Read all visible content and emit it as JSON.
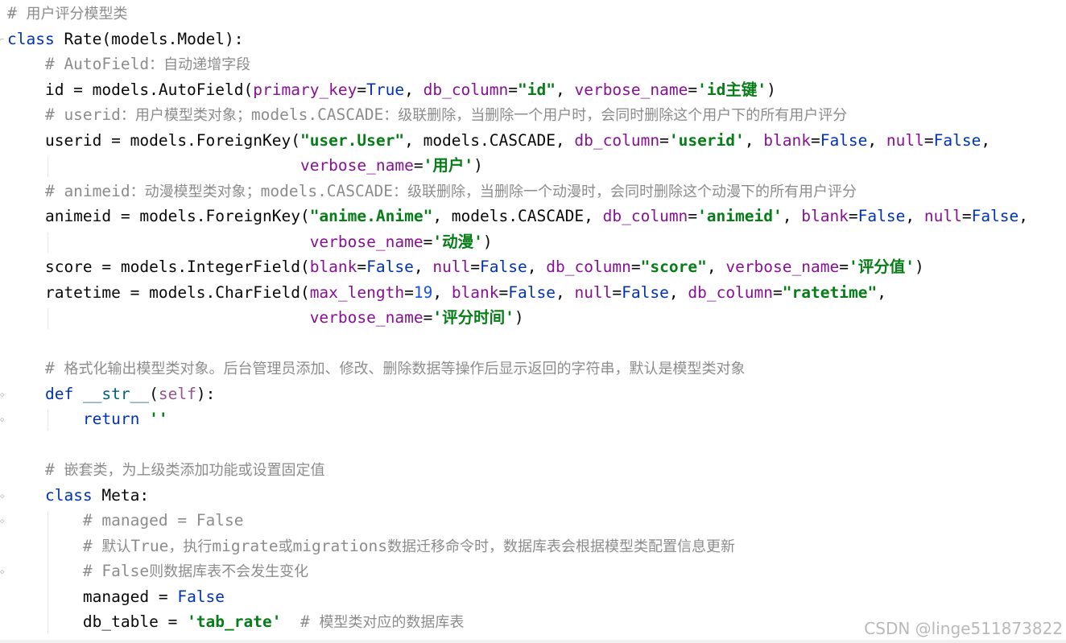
{
  "editor": {
    "lines": [
      [
        [
          "# ",
          "c"
        ],
        [
          "用户评分模型类",
          "cz"
        ]
      ],
      [
        [
          "class ",
          "k"
        ],
        [
          "Rate(models.Model):",
          ""
        ]
      ],
      [
        [
          "    # AutoField",
          "c"
        ],
        [
          "：自动递增字段",
          "cz"
        ]
      ],
      [
        [
          "    id = models.AutoField(",
          ""
        ],
        [
          "primary_key",
          "p"
        ],
        [
          "=",
          ""
        ],
        [
          "True",
          "k"
        ],
        [
          ", ",
          ""
        ],
        [
          "db_column",
          "p"
        ],
        [
          "=",
          ""
        ],
        [
          "\"id\"",
          "s"
        ],
        [
          ", ",
          ""
        ],
        [
          "verbose_name",
          "p"
        ],
        [
          "=",
          ""
        ],
        [
          "'id",
          "s"
        ],
        [
          "主键",
          "sz"
        ],
        [
          "'",
          "s"
        ],
        [
          ")",
          ""
        ]
      ],
      [
        [
          "    # userid",
          "c"
        ],
        [
          "：用户模型类对象；",
          "cz"
        ],
        [
          "models.CASCADE",
          "c"
        ],
        [
          "：级联删除，当删除一个用户时，会同时删除这个用户下的所有用户评分",
          "cz"
        ]
      ],
      [
        [
          "    userid = models.ForeignKey(",
          ""
        ],
        [
          "\"user.User\"",
          "s"
        ],
        [
          ", models.CASCADE, ",
          ""
        ],
        [
          "db_column",
          "p"
        ],
        [
          "=",
          ""
        ],
        [
          "'userid'",
          "s"
        ],
        [
          ", ",
          ""
        ],
        [
          "blank",
          "p"
        ],
        [
          "=",
          ""
        ],
        [
          "False",
          "k"
        ],
        [
          ", ",
          ""
        ],
        [
          "null",
          "p"
        ],
        [
          "=",
          ""
        ],
        [
          "False",
          "k"
        ],
        [
          ",",
          ""
        ]
      ],
      [
        [
          "                               ",
          ""
        ],
        [
          "verbose_name",
          "p"
        ],
        [
          "=",
          ""
        ],
        [
          "'",
          "s"
        ],
        [
          "用户",
          "sz"
        ],
        [
          "'",
          "s"
        ],
        [
          ")",
          ""
        ]
      ],
      [
        [
          "    # animeid",
          "c"
        ],
        [
          "：动漫模型类对象；",
          "cz"
        ],
        [
          "models.CASCADE",
          "c"
        ],
        [
          "：级联删除，当删除一个动漫时，会同时删除这个动漫下的所有用户评分",
          "cz"
        ]
      ],
      [
        [
          "    animeid = models.ForeignKey(",
          ""
        ],
        [
          "\"anime.Anime\"",
          "s"
        ],
        [
          ", models.CASCADE, ",
          ""
        ],
        [
          "db_column",
          "p"
        ],
        [
          "=",
          ""
        ],
        [
          "'animeid'",
          "s"
        ],
        [
          ", ",
          ""
        ],
        [
          "blank",
          "p"
        ],
        [
          "=",
          ""
        ],
        [
          "False",
          "k"
        ],
        [
          ", ",
          ""
        ],
        [
          "null",
          "p"
        ],
        [
          "=",
          ""
        ],
        [
          "False",
          "k"
        ],
        [
          ",",
          ""
        ]
      ],
      [
        [
          "                                ",
          ""
        ],
        [
          "verbose_name",
          "p"
        ],
        [
          "=",
          ""
        ],
        [
          "'",
          "s"
        ],
        [
          "动漫",
          "sz"
        ],
        [
          "'",
          "s"
        ],
        [
          ")",
          ""
        ]
      ],
      [
        [
          "    score = models.IntegerField(",
          ""
        ],
        [
          "blank",
          "p"
        ],
        [
          "=",
          ""
        ],
        [
          "False",
          "k"
        ],
        [
          ", ",
          ""
        ],
        [
          "null",
          "p"
        ],
        [
          "=",
          ""
        ],
        [
          "False",
          "k"
        ],
        [
          ", ",
          ""
        ],
        [
          "db_column",
          "p"
        ],
        [
          "=",
          ""
        ],
        [
          "\"score\"",
          "s"
        ],
        [
          ", ",
          ""
        ],
        [
          "verbose_name",
          "p"
        ],
        [
          "=",
          ""
        ],
        [
          "'",
          "s"
        ],
        [
          "评分值",
          "sz"
        ],
        [
          "'",
          "s"
        ],
        [
          ")",
          ""
        ]
      ],
      [
        [
          "    ratetime = models.CharField(",
          ""
        ],
        [
          "max_length",
          "p"
        ],
        [
          "=",
          ""
        ],
        [
          "19",
          "n"
        ],
        [
          ", ",
          ""
        ],
        [
          "blank",
          "p"
        ],
        [
          "=",
          ""
        ],
        [
          "False",
          "k"
        ],
        [
          ", ",
          ""
        ],
        [
          "null",
          "p"
        ],
        [
          "=",
          ""
        ],
        [
          "False",
          "k"
        ],
        [
          ", ",
          ""
        ],
        [
          "db_column",
          "p"
        ],
        [
          "=",
          ""
        ],
        [
          "\"ratetime\"",
          "s"
        ],
        [
          ",",
          ""
        ]
      ],
      [
        [
          "                                ",
          ""
        ],
        [
          "verbose_name",
          "p"
        ],
        [
          "=",
          ""
        ],
        [
          "'",
          "s"
        ],
        [
          "评分时间",
          "sz"
        ],
        [
          "'",
          "s"
        ],
        [
          ")",
          ""
        ]
      ],
      [],
      [
        [
          "    # ",
          "c"
        ],
        [
          "格式化输出模型类对象。后台管理员添加、修改、删除数据等操作后显示返回的字符串，默认是模型类对象",
          "cz"
        ]
      ],
      [
        [
          "    ",
          ""
        ],
        [
          "def ",
          "k"
        ],
        [
          "__str__",
          "fn"
        ],
        [
          "(",
          ""
        ],
        [
          "self",
          "sl"
        ],
        [
          "):",
          ""
        ]
      ],
      [
        [
          "        ",
          ""
        ],
        [
          "return ",
          "k"
        ],
        [
          "''",
          "s"
        ]
      ],
      [],
      [
        [
          "    # ",
          "c"
        ],
        [
          "嵌套类，为上级类添加功能或设置固定值",
          "cz"
        ]
      ],
      [
        [
          "    ",
          ""
        ],
        [
          "class ",
          "k"
        ],
        [
          "Meta:",
          ""
        ]
      ],
      [
        [
          "        # managed = False",
          "c"
        ]
      ],
      [
        [
          "        # ",
          "c"
        ],
        [
          "默认",
          "cz"
        ],
        [
          "True",
          "c"
        ],
        [
          "，执行",
          "cz"
        ],
        [
          "migrate",
          "c"
        ],
        [
          "或",
          "cz"
        ],
        [
          "migrations",
          "c"
        ],
        [
          "数据迁移命令时，数据库表会根据模型类配置信息更新",
          "cz"
        ]
      ],
      [
        [
          "        # False",
          "c"
        ],
        [
          "则数据库表不会发生变化",
          "cz"
        ]
      ],
      [
        [
          "        managed = ",
          ""
        ],
        [
          "False",
          "k"
        ]
      ],
      [
        [
          "        db_table = ",
          ""
        ],
        [
          "'tab_rate'",
          "s"
        ],
        [
          "  # ",
          "c"
        ],
        [
          "模型类对应的数据库表",
          "cz"
        ]
      ]
    ],
    "fold_markers": {
      "1": "⌐",
      "15": "◇",
      "16": "◇",
      "19": "◇",
      "20": "◇",
      "22": "◇"
    }
  },
  "watermark": {
    "text": "CSDN @linge511873822"
  }
}
